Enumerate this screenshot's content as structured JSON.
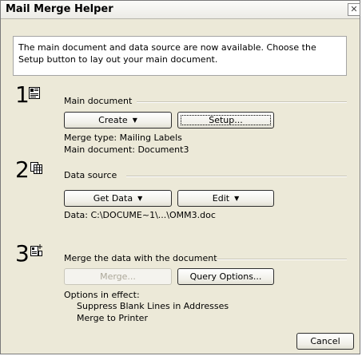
{
  "dialog": {
    "title": "Mail Merge Helper",
    "close_glyph": "✕",
    "intro_text": "The main document and data source are now available. Choose the Setup button to lay out your main document."
  },
  "step1": {
    "number": "1",
    "icon": "main-document-icon",
    "label": "Main document",
    "create_button": "Create",
    "setup_button": "Setup...",
    "merge_type": "Merge type: Mailing Labels",
    "main_document": "Main document: Document3"
  },
  "step2": {
    "number": "2",
    "icon": "data-source-icon",
    "label": "Data source",
    "get_data_button": "Get Data",
    "edit_button": "Edit",
    "data_path": "Data: C:\\DOCUME~1\\...\\OMM3.doc"
  },
  "step3": {
    "number": "3",
    "icon": "merge-icon",
    "label": "Merge the data with the document",
    "merge_button": "Merge...",
    "query_options_button": "Query Options...",
    "options_heading": "Options in effect:",
    "options": [
      "Suppress Blank Lines in Addresses",
      "Merge to Printer"
    ]
  },
  "footer": {
    "cancel_button": "Cancel"
  },
  "colors": {
    "dialog_bg": "#ece9d8",
    "button_border": "#2e2e2e",
    "disabled_text": "#aca899"
  }
}
